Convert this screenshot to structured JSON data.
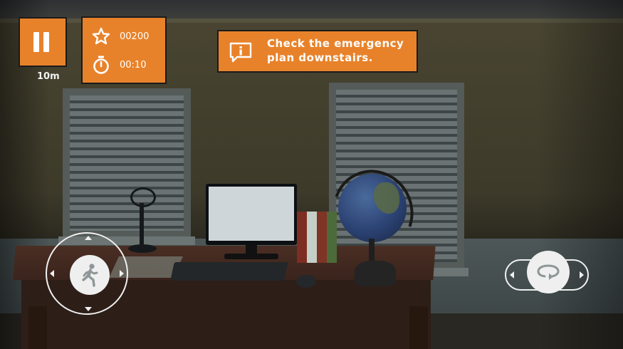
{
  "hud": {
    "distance": "10m",
    "score": "00200",
    "timer": "00:10",
    "hint": "Check the emergency plan downstairs."
  },
  "icons": {
    "pause": "pause-icon",
    "score": "star-icon",
    "timer": "stopwatch-icon",
    "hint": "info-icon",
    "move": "walking-person-icon",
    "rotate": "rotate-icon"
  },
  "colors": {
    "hud_orange": "#e8822a",
    "hud_border": "#1b1b1b",
    "control_white": "#efefef"
  }
}
